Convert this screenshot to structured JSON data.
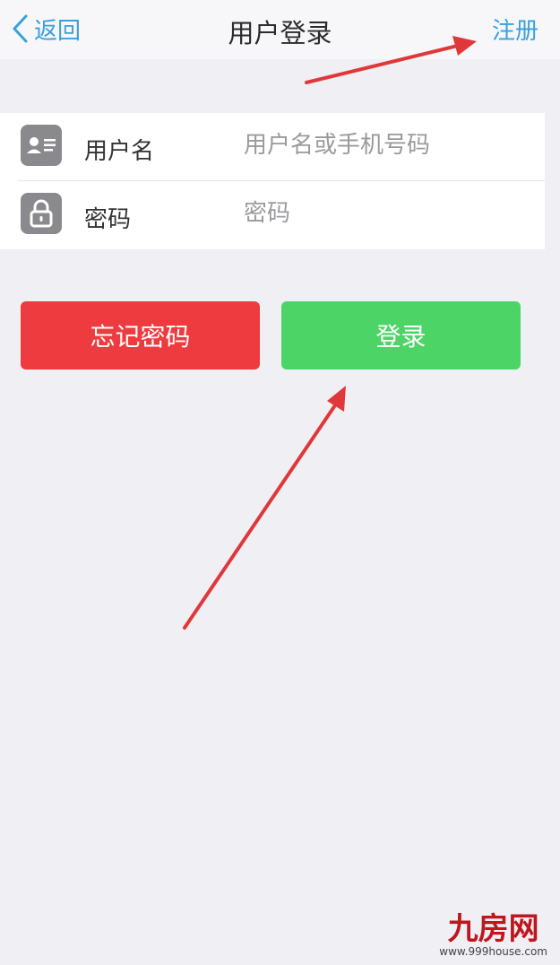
{
  "navbar": {
    "back_label": "返回",
    "title": "用户登录",
    "register_label": "注册",
    "accent_color": "#3aa0dc"
  },
  "form": {
    "username": {
      "label": "用户名",
      "placeholder": "用户名或手机号码",
      "icon": "id-card-icon"
    },
    "password": {
      "label": "密码",
      "placeholder": "密码",
      "icon": "lock-icon"
    }
  },
  "buttons": {
    "forgot_label": "忘记密码",
    "forgot_color": "#ee3b3f",
    "login_label": "登录",
    "login_color": "#4dd466"
  },
  "annotations": {
    "arrow_color": "#e0383a"
  },
  "watermark": {
    "logo": "九房网",
    "url": "www.999house.com"
  }
}
